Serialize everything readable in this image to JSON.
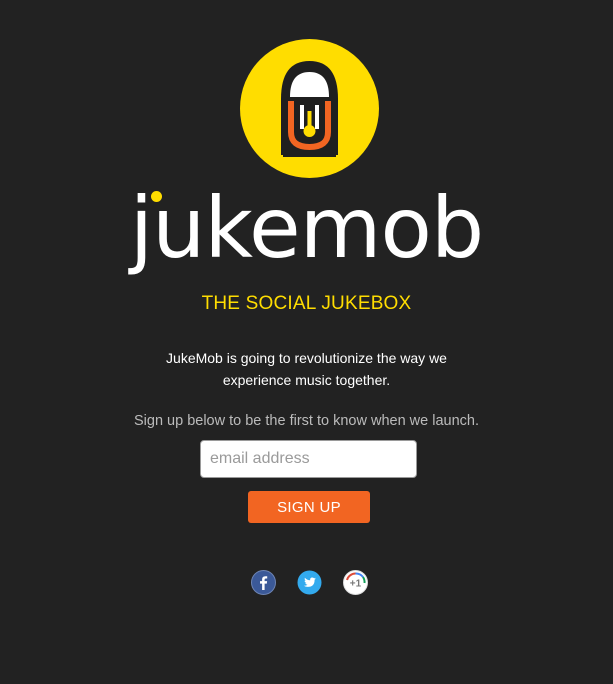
{
  "brand": {
    "wordmark": "jukemob",
    "tagline": "THE SOCIAL JUKEBOX",
    "colors": {
      "accent_yellow": "#ffdd00",
      "accent_orange": "#f26522",
      "background": "#222222"
    }
  },
  "main": {
    "description": "JukeMob is going to revolutionize the way we experience music together.",
    "signup_prompt": "Sign up below to be the first to know when we launch."
  },
  "form": {
    "email_placeholder": "email address",
    "email_value": "",
    "submit_label": "SIGN UP"
  },
  "social": {
    "icons": [
      "facebook-icon",
      "twitter-icon",
      "google-plus-icon"
    ],
    "google_plus_label": "+1"
  }
}
